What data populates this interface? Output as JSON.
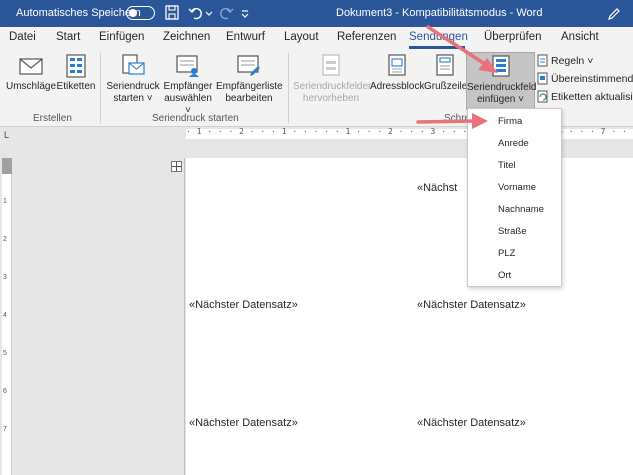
{
  "titlebar": {
    "autosave_label": "Automatisches Speichern",
    "document_title": "Dokument3 - Kompatibilitätsmodus - Word"
  },
  "tabs": [
    {
      "label": "Datei"
    },
    {
      "label": "Start"
    },
    {
      "label": "Einfügen"
    },
    {
      "label": "Zeichnen"
    },
    {
      "label": "Entwurf"
    },
    {
      "label": "Layout"
    },
    {
      "label": "Referenzen"
    },
    {
      "label": "Sendungen",
      "active": true
    },
    {
      "label": "Überprüfen"
    },
    {
      "label": "Ansicht"
    }
  ],
  "ribbon": {
    "erstellen": {
      "umschlaege": "Umschläge",
      "etiketten": "Etiketten",
      "group_label": "Erstellen"
    },
    "seriendruck_starten": {
      "start_line1": "Seriendruck",
      "start_line2": "starten",
      "empfaenger_line1": "Empfänger",
      "empfaenger_line2": "auswählen",
      "liste_line1": "Empfängerliste",
      "liste_line2": "bearbeiten",
      "group_label": "Seriendruck starten"
    },
    "felder": {
      "hervorheben_line1": "Seriendruckfelder",
      "hervorheben_line2": "hervorheben",
      "adressblock": "Adressblock",
      "grusszeile": "Grußzeile",
      "einfuegen_line1": "Seriendruckfeld",
      "einfuegen_line2": "einfügen",
      "group_label_partial": "Schre"
    },
    "regeln": "Regeln",
    "uebereinstimmende": "Übereinstimmende",
    "etiketten_aktualisieren": "Etiketten aktualisieren"
  },
  "dropdown": {
    "items": [
      "Firma",
      "Anrede",
      "Titel",
      "Vorname",
      "Nachname",
      "Straße",
      "PLZ",
      "Ort"
    ]
  },
  "document": {
    "record_field": "«Nächster Datensatz»",
    "record_field_partial": "«Nächst"
  },
  "ruler": {
    "tab_marker": "L",
    "text": "· 1 · · · 2 · · · 1 · · · · · 1 · · · 2 · · · 3 · · · 4 · · · 5 · · · 6 · · · 7 · ·",
    "vertical_numbers": [
      "1",
      "2",
      "3",
      "4",
      "5",
      "6",
      "7"
    ]
  },
  "colors": {
    "word_blue": "#2b579a",
    "arrow_red": "#e8717a"
  }
}
